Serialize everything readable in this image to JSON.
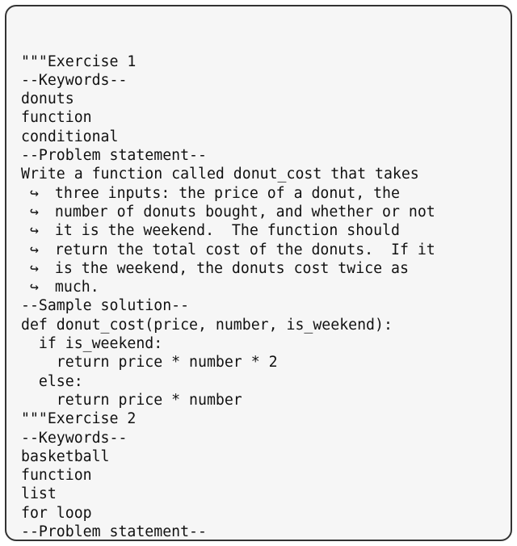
{
  "code": {
    "lines": [
      {
        "cont": false,
        "text": "\"\"\"Exercise 1"
      },
      {
        "cont": false,
        "text": "--Keywords--"
      },
      {
        "cont": false,
        "text": "donuts"
      },
      {
        "cont": false,
        "text": "function"
      },
      {
        "cont": false,
        "text": "conditional"
      },
      {
        "cont": false,
        "text": "--Problem statement--"
      },
      {
        "cont": false,
        "text": "Write a function called donut_cost that takes"
      },
      {
        "cont": true,
        "text": " three inputs: the price of a donut, the"
      },
      {
        "cont": true,
        "text": " number of donuts bought, and whether or not"
      },
      {
        "cont": true,
        "text": " it is the weekend.  The function should"
      },
      {
        "cont": true,
        "text": " return the total cost of the donuts.  If it"
      },
      {
        "cont": true,
        "text": " is the weekend, the donuts cost twice as"
      },
      {
        "cont": true,
        "text": " much."
      },
      {
        "cont": false,
        "text": "--Sample solution--"
      },
      {
        "cont": false,
        "text": "def donut_cost(price, number, is_weekend):"
      },
      {
        "cont": false,
        "text": "  if is_weekend:"
      },
      {
        "cont": false,
        "text": "    return price * number * 2"
      },
      {
        "cont": false,
        "text": "  else:"
      },
      {
        "cont": false,
        "text": "    return price * number"
      },
      {
        "cont": false,
        "text": "\"\"\"Exercise 2"
      },
      {
        "cont": false,
        "text": "--Keywords--"
      },
      {
        "cont": false,
        "text": "basketball"
      },
      {
        "cont": false,
        "text": "function"
      },
      {
        "cont": false,
        "text": "list"
      },
      {
        "cont": false,
        "text": "for loop"
      },
      {
        "cont": false,
        "text": "--Problem statement--"
      }
    ]
  },
  "glyphs": {
    "continuation_arrow": "↪"
  }
}
